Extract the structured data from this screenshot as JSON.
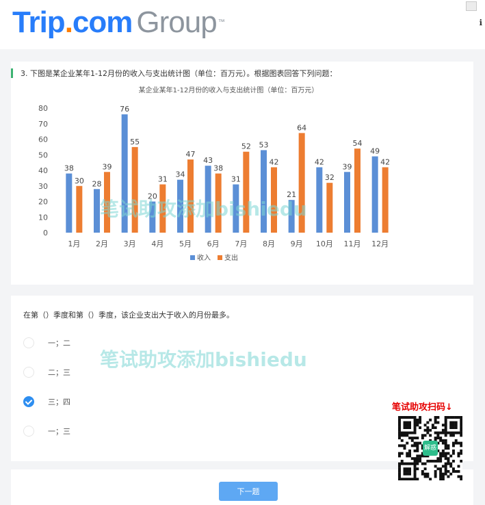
{
  "header": {
    "logo": {
      "trip": "Trip",
      "dot": ".",
      "com": "com",
      "group": "Group",
      "tm": "™"
    },
    "right_char": "ℹ"
  },
  "question": {
    "text": "3. 下图是某企业某年1-12月份的收入与支出统计图（单位：百万元）。根据图表回答下列问题："
  },
  "colors": {
    "income": "#5b8fd6",
    "expense": "#ed7d31",
    "accent": "#2e8ef0"
  },
  "chart_data": {
    "type": "bar",
    "title": "某企业某年1-12月份的收入与支出统计图（单位：百万元）",
    "categories": [
      "1月",
      "2月",
      "3月",
      "4月",
      "5月",
      "6月",
      "7月",
      "8月",
      "9月",
      "10月",
      "11月",
      "12月"
    ],
    "series": [
      {
        "name": "收入",
        "values": [
          38,
          28,
          76,
          20,
          34,
          43,
          31,
          53,
          21,
          42,
          39,
          49
        ]
      },
      {
        "name": "支出",
        "values": [
          30,
          39,
          55,
          31,
          47,
          38,
          52,
          42,
          64,
          32,
          54,
          42
        ]
      }
    ],
    "yticks": [
      0,
      10,
      20,
      30,
      40,
      50,
      60,
      70,
      80
    ],
    "ylim": [
      0,
      80
    ],
    "legend": "bottom",
    "grid": false
  },
  "sub_question": {
    "text": "在第（）季度和第（）季度，该企业支出大于收入的月份最多。",
    "options": [
      {
        "label": "一；二",
        "checked": false
      },
      {
        "label": "二；三",
        "checked": false
      },
      {
        "label": "三；四",
        "checked": true
      },
      {
        "label": "一；三",
        "checked": false
      }
    ]
  },
  "next_button": "下一题",
  "watermark": "笔试助攻添加bishiedu",
  "qr": {
    "label": "笔试助攻扫码↓",
    "center_text": "解惑"
  }
}
